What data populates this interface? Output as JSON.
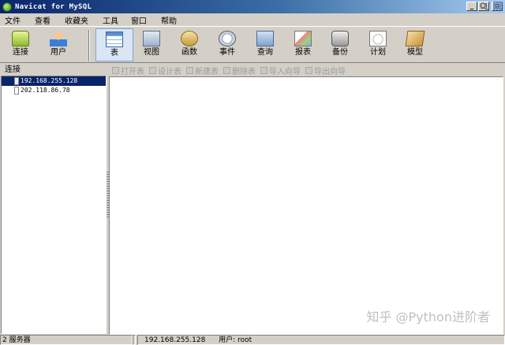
{
  "window": {
    "title": "Navicat for MySQL",
    "minimize": "_",
    "maximize": "□",
    "close": "×"
  },
  "menu": [
    "文件",
    "查看",
    "收藏夹",
    "工具",
    "窗口",
    "帮助"
  ],
  "toolbar": {
    "buttons": [
      {
        "label": "连接",
        "icon": "connect-icon"
      },
      {
        "label": "用户",
        "icon": "user-icon"
      },
      {
        "label": "表",
        "icon": "table-icon",
        "active": true
      },
      {
        "label": "视图",
        "icon": "view-icon"
      },
      {
        "label": "函数",
        "icon": "function-icon"
      },
      {
        "label": "事件",
        "icon": "event-icon"
      },
      {
        "label": "查询",
        "icon": "query-icon"
      },
      {
        "label": "报表",
        "icon": "report-icon"
      },
      {
        "label": "备份",
        "icon": "backup-icon"
      },
      {
        "label": "计划",
        "icon": "schedule-icon"
      },
      {
        "label": "模型",
        "icon": "model-icon"
      }
    ]
  },
  "connections": {
    "header": "连接",
    "items": [
      {
        "label": "192.168.255.128",
        "selected": true
      },
      {
        "label": "202.118.86.78",
        "selected": false
      }
    ]
  },
  "object_toolbar": {
    "buttons": [
      "打开表",
      "设计表",
      "新建表",
      "删除表",
      "导入向导",
      "导出向导"
    ],
    "enabled": false
  },
  "watermark": "知乎 @Python进阶者",
  "status": {
    "count": "2 服务器",
    "host": "192.168.255.128",
    "user": "用户: root"
  },
  "colors": {
    "titlebar": "#0a246a",
    "selection": "#0a246a",
    "chrome": "#d4d0c8"
  }
}
